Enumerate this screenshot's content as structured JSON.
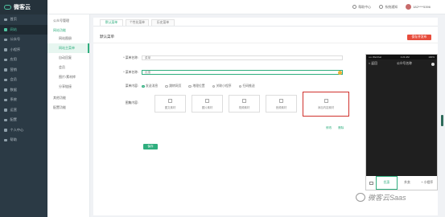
{
  "app": {
    "logo_text": "微客云"
  },
  "sidebar": {
    "items": [
      {
        "label": "首页"
      },
      {
        "label": "网站"
      },
      {
        "label": "公众号"
      },
      {
        "label": "小程序"
      },
      {
        "label": "应用"
      },
      {
        "label": "营销"
      },
      {
        "label": "会员"
      },
      {
        "label": "数据"
      },
      {
        "label": "系统"
      },
      {
        "label": "运营"
      },
      {
        "label": "配置"
      },
      {
        "label": "个人中心"
      },
      {
        "label": "帮助"
      }
    ]
  },
  "subnav": {
    "group1": "公众号管理",
    "group2": "网站功能",
    "items": [
      {
        "label": "网站图册"
      },
      {
        "label": "网站主菜单"
      },
      {
        "label": "自动回复"
      },
      {
        "label": "会员"
      },
      {
        "label": "图片/素材库"
      },
      {
        "label": "分享链接"
      }
    ],
    "group3": "其他功能",
    "group4": "配置功能"
  },
  "topbar": {
    "help": "帮助中心",
    "notice": "系统通知",
    "user": "182****5396"
  },
  "tabs": [
    {
      "label": "默认菜单"
    },
    {
      "label": "个性化菜单"
    },
    {
      "label": "历史菜单"
    }
  ],
  "panel": {
    "title": "默认菜单",
    "publish_button": "保存并发布"
  },
  "form": {
    "menu_name_label": "* 菜单名称:",
    "menu_name_value": "菜单",
    "submenu_name_label": "* 菜单名称:",
    "submenu_name_value": "优惠",
    "content_label": "菜单内容:",
    "radios": [
      {
        "label": "发送消息",
        "checked": true
      },
      {
        "label": "跳转网页",
        "checked": false
      },
      {
        "label": "地理位置",
        "checked": false
      },
      {
        "label": "关联小程序",
        "checked": false
      },
      {
        "label": "扫码推送",
        "checked": false
      }
    ],
    "material_label": "图集内容:",
    "cards": [
      {
        "label": "图文素材",
        "icon": "article-icon"
      },
      {
        "label": "图片素材",
        "icon": "image-icon"
      },
      {
        "label": "视频素材",
        "icon": "video-icon"
      },
      {
        "label": "音频素材",
        "icon": "audio-icon"
      },
      {
        "label": "添加内容素材",
        "icon": "add-icon"
      }
    ],
    "link_left": "修改",
    "link_right": "删除",
    "save_button": "保存"
  },
  "phone": {
    "carrier": "•••• WeChat",
    "time": "1:21 AM",
    "battery": "100%",
    "title": "公众号名称",
    "back": "< 返回",
    "footer": [
      {
        "label": "优惠",
        "selected": true
      },
      {
        "label": "外卖",
        "selected": false
      },
      {
        "label": "+ 小程序",
        "selected": false
      }
    ]
  },
  "watermark": "微客云Saas",
  "colors": {
    "accent": "#2fae7e",
    "sidebar": "#2b3a45",
    "danger": "#e74c3c"
  }
}
